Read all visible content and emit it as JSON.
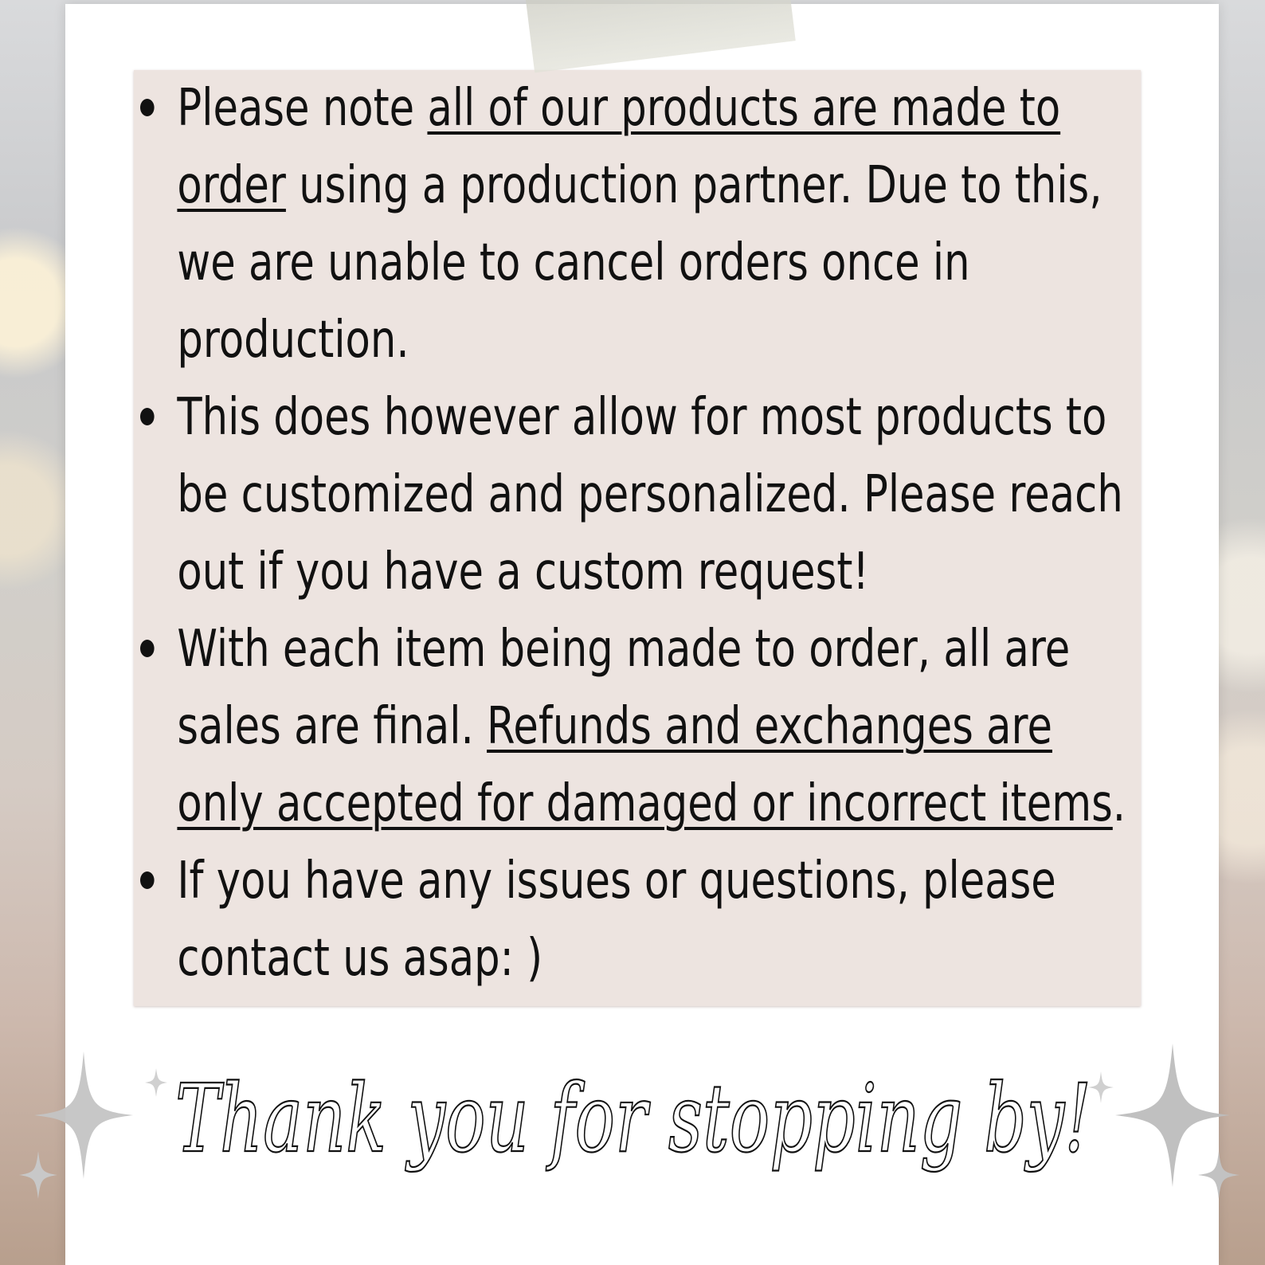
{
  "notes": [
    {
      "lines": [
        {
          "parts": [
            {
              "text": "Please note ",
              "underline": false
            },
            {
              "text": "all of our products are made to",
              "underline": true
            }
          ]
        },
        {
          "parts": [
            {
              "text": "order",
              "underline": true
            },
            {
              "text": " using a production partner. Due to this,",
              "underline": false
            }
          ]
        },
        {
          "parts": [
            {
              "text": "we are unable to cancel orders once in",
              "underline": false
            }
          ]
        },
        {
          "parts": [
            {
              "text": "production.",
              "underline": false
            }
          ]
        }
      ]
    },
    {
      "lines": [
        {
          "parts": [
            {
              "text": "This does however allow for most products to",
              "underline": false
            }
          ]
        },
        {
          "parts": [
            {
              "text": "be customized and personalized. Please reach",
              "underline": false
            }
          ]
        },
        {
          "parts": [
            {
              "text": "out if you have a custom request!",
              "underline": false
            }
          ]
        }
      ]
    },
    {
      "lines": [
        {
          "parts": [
            {
              "text": "With each item being made to order, all are",
              "underline": false
            }
          ]
        },
        {
          "parts": [
            {
              "text": "sales are final. ",
              "underline": false
            },
            {
              "text": "Refunds and exchanges are",
              "underline": true
            }
          ]
        },
        {
          "parts": [
            {
              "text": "only accepted for damaged or incorrect items",
              "underline": true
            },
            {
              "text": ".",
              "underline": false
            }
          ]
        }
      ]
    },
    {
      "lines": [
        {
          "parts": [
            {
              "text": "If you have any issues or questions, please",
              "underline": false
            }
          ]
        },
        {
          "parts": [
            {
              "text": "contact us asap: )",
              "underline": false
            }
          ]
        }
      ]
    }
  ],
  "thank_you": "Thank you for stopping by!",
  "colors": {
    "panel": "#ede4e0",
    "card": "#ffffff",
    "text": "#111111",
    "sparkle": "#b9b9b9"
  }
}
